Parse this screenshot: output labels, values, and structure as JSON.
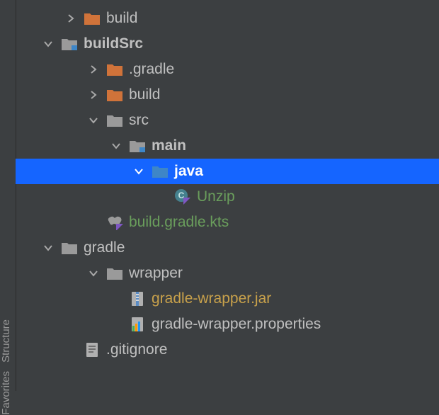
{
  "tree": {
    "build": "build",
    "buildSrc": "buildSrc",
    "dot_gradle": ".gradle",
    "build2": "build",
    "src": "src",
    "main": "main",
    "java": "java",
    "unzip": "Unzip",
    "build_gradle_kts": "build.gradle.kts",
    "gradle": "gradle",
    "wrapper": "wrapper",
    "wrapper_jar": "gradle-wrapper.jar",
    "wrapper_props": "gradle-wrapper.properties",
    "gitignore": ".gitignore"
  },
  "tool_windows": {
    "structure": "Structure",
    "favorites": "Favorites"
  },
  "colors": {
    "folder_orange": "#d0733a",
    "folder_grey": "#9a9a9a",
    "source_blue": "#3e86c7",
    "green": "#6a9e5c",
    "selection": "#1565ff"
  }
}
